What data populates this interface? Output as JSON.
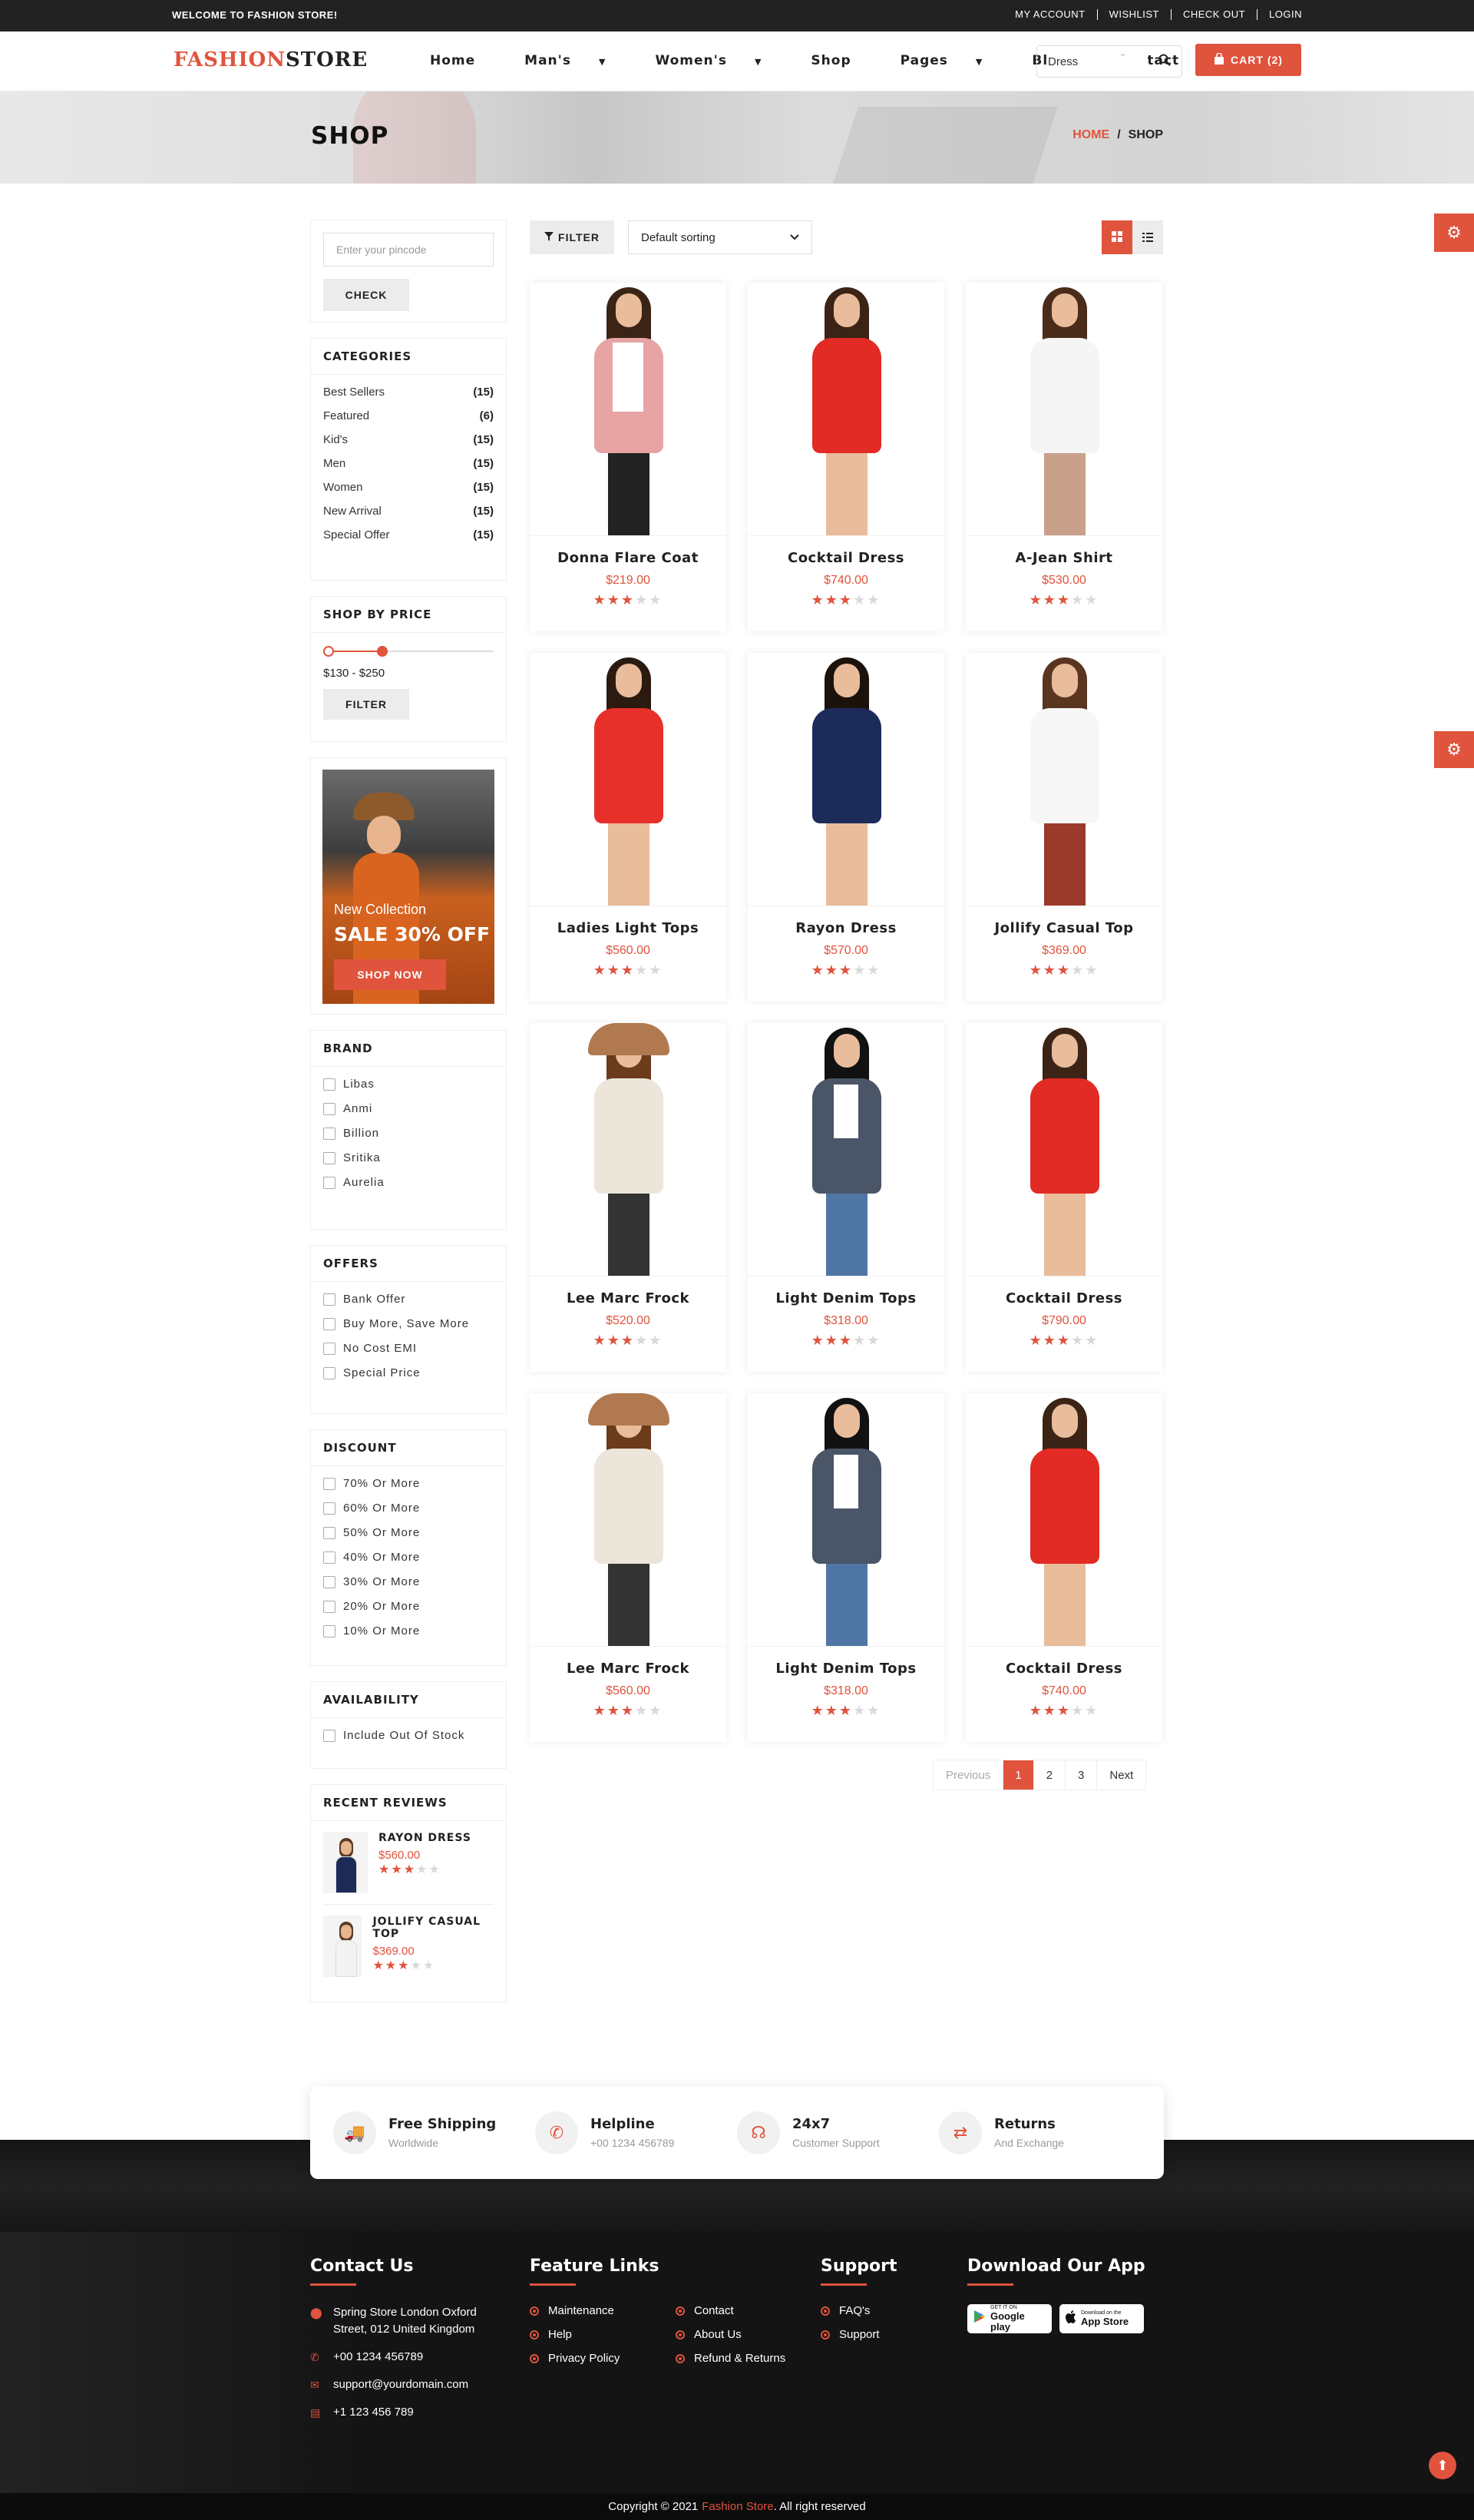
{
  "topbar": {
    "welcome": "WELCOME TO FASHION STORE!",
    "links": [
      "MY ACCOUNT",
      "WISHLIST",
      "CHECK OUT",
      "LOGIN"
    ]
  },
  "header": {
    "logo_a": "FA",
    "logo_b": "SHION",
    "logo_c": "STORE",
    "nav": [
      {
        "label": "Home",
        "caret": false
      },
      {
        "label": "Man's",
        "caret": true
      },
      {
        "label": "Women's",
        "caret": true
      },
      {
        "label": "Shop",
        "caret": false
      },
      {
        "label": "Pages",
        "caret": true
      },
      {
        "label": "Blog",
        "caret": false
      },
      {
        "label": "Contact",
        "caret": false
      }
    ],
    "search_value": "Dress",
    "cart_label": "CART (2)"
  },
  "banner": {
    "title": "SHOP",
    "crumb_home": "HOME",
    "crumb_sep": "/",
    "crumb_current": "SHOP"
  },
  "sidebar": {
    "pincode_placeholder": "Enter your pincode",
    "check_label": "CHECK",
    "categories_title": "CATEGORIES",
    "categories": [
      {
        "name": "Best Sellers",
        "count": "(15)"
      },
      {
        "name": "Featured",
        "count": "(6)"
      },
      {
        "name": "Kid's",
        "count": "(15)"
      },
      {
        "name": "Men",
        "count": "(15)"
      },
      {
        "name": "Women",
        "count": "(15)"
      },
      {
        "name": "New Arrival",
        "count": "(15)"
      },
      {
        "name": "Special Offer",
        "count": "(15)"
      }
    ],
    "price_title": "SHOP BY PRICE",
    "price_range": "$130 - $250",
    "price_filter_label": "FILTER",
    "promo": {
      "line1": "New Collection",
      "line2": "SALE 30% OFF",
      "button": "SHOP NOW"
    },
    "brand_title": "BRAND",
    "brands": [
      "Libas",
      "Anmi",
      "Billion",
      "Sritika",
      "Aurelia"
    ],
    "offers_title": "OFFERS",
    "offers": [
      "Bank Offer",
      "Buy More, Save More",
      "No Cost EMI",
      "Special Price"
    ],
    "discount_title": "DISCOUNT",
    "discounts": [
      "70% Or More",
      "60% Or More",
      "50% Or More",
      "40% Or More",
      "30% Or More",
      "20% Or More",
      "10% Or More"
    ],
    "availability_title": "AVAILABILITY",
    "availability": [
      "Include Out Of Stock"
    ],
    "reviews_title": "RECENT REVIEWS",
    "reviews": [
      {
        "name": "RAYON DRESS",
        "price": "$560.00",
        "rating": 3
      },
      {
        "name": "JOLLIFY CASUAL TOP",
        "price": "$369.00",
        "rating": 3
      }
    ]
  },
  "toolbar": {
    "filter_label": "FILTER",
    "sort_value": "Default sorting"
  },
  "products": [
    {
      "name": "Donna Flare Coat",
      "price": "$219.00",
      "rating": 3,
      "style": "coat"
    },
    {
      "name": "Cocktail Dress",
      "price": "$740.00",
      "rating": 3,
      "style": "red"
    },
    {
      "name": "A-Jean Shirt",
      "price": "$530.00",
      "rating": 3,
      "style": "white"
    },
    {
      "name": "Ladies Light Tops",
      "price": "$560.00",
      "rating": 3,
      "style": "reddot"
    },
    {
      "name": "Rayon Dress",
      "price": "$570.00",
      "rating": 3,
      "style": "navy"
    },
    {
      "name": "Jollify Casual Top",
      "price": "$369.00",
      "rating": 3,
      "style": "shirt"
    },
    {
      "name": "Lee Marc Frock",
      "price": "$520.00",
      "rating": 3,
      "style": "hat"
    },
    {
      "name": "Light Denim Tops",
      "price": "$318.00",
      "rating": 3,
      "style": "plaid"
    },
    {
      "name": "Cocktail Dress",
      "price": "$790.00",
      "rating": 3,
      "style": "red"
    },
    {
      "name": "Lee Marc Frock",
      "price": "$560.00",
      "rating": 3,
      "style": "hat"
    },
    {
      "name": "Light Denim Tops",
      "price": "$318.00",
      "rating": 3,
      "style": "plaid"
    },
    {
      "name": "Cocktail Dress",
      "price": "$740.00",
      "rating": 3,
      "style": "red"
    }
  ],
  "pagination": {
    "prev": "Previous",
    "pages": [
      "1",
      "2",
      "3"
    ],
    "current": "1",
    "next": "Next"
  },
  "features": [
    {
      "title": "Free Shipping",
      "sub": "Worldwide",
      "icon": "truck-icon"
    },
    {
      "title": "Helpline",
      "sub": "+00 1234 456789",
      "icon": "phone-icon"
    },
    {
      "title": "24x7",
      "sub": "Customer Support",
      "icon": "headset-icon"
    },
    {
      "title": "Returns",
      "sub": "And Exchange",
      "icon": "exchange-icon"
    }
  ],
  "footer": {
    "contact_title": "Contact Us",
    "address_line1": "Spring Store London Oxford",
    "address_line2": "Street, 012 United Kingdom",
    "phone": "+00 1234 456789",
    "email": "support@yourdomain.com",
    "fax": "+1 123 456 789",
    "feature_title": "Feature Links",
    "feature_links_a": [
      "Maintenance",
      "Help",
      "Privacy Policy"
    ],
    "feature_links_b": [
      "Contact",
      "About Us",
      "Refund & Returns"
    ],
    "support_title": "Support",
    "support_links": [
      "FAQ's",
      "Support"
    ],
    "app_title": "Download Our App",
    "google_top": "GET IT ON",
    "google_name": "Google play",
    "apple_top": "Download on the",
    "apple_name": "App Store"
  },
  "copyright": {
    "pre": "Copyright © 2021",
    "brand": "Fashion Store",
    "post": ". All right reserved"
  },
  "colors": {
    "accent": "#e0533d",
    "dark": "#222222"
  }
}
